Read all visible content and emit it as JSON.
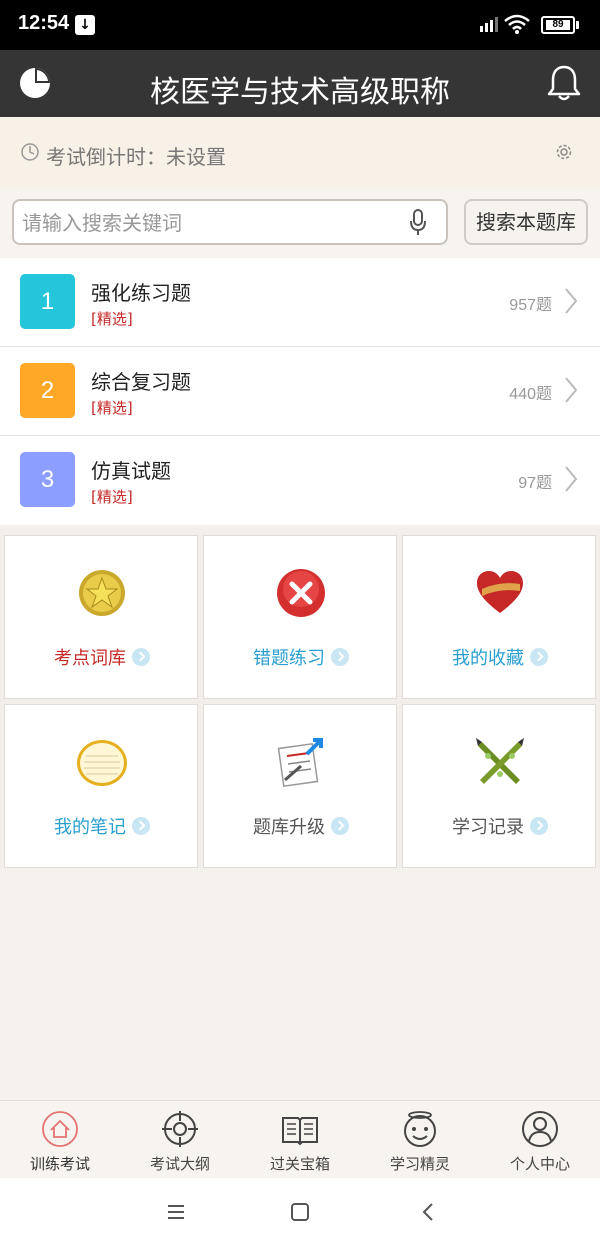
{
  "status_bar": {
    "time": "12:54",
    "battery": "89"
  },
  "header": {
    "title": "核医学与技术高级职称"
  },
  "countdown": {
    "label": "考试倒计时：未设置"
  },
  "search": {
    "placeholder": "请输入搜索关键词",
    "value": "",
    "button_label": "搜索本题库"
  },
  "banks": [
    {
      "number": "1",
      "title": "强化练习题",
      "tag": "[精选]",
      "count": "957题",
      "color": "#26c6da"
    },
    {
      "number": "2",
      "title": "综合复习题",
      "tag": "[精选]",
      "count": "440题",
      "color": "#ffa726"
    },
    {
      "number": "3",
      "title": "仿真试题",
      "tag": "[精选]",
      "count": "97题",
      "color": "#8c9eff"
    }
  ],
  "tiles": [
    {
      "label": "考点词库",
      "icon": "gold-star-badge-icon",
      "color": "#c62828"
    },
    {
      "label": "错题练习",
      "icon": "red-x-circle-icon",
      "color": "#2a9fd0"
    },
    {
      "label": "我的收藏",
      "icon": "red-heart-icon",
      "color": "#2a9fd0"
    },
    {
      "label": "我的笔记",
      "icon": "notepad-icon",
      "color": "#2a9fd0"
    },
    {
      "label": "题库升级",
      "icon": "document-upgrade-icon",
      "color": "#555555"
    },
    {
      "label": "学习记录",
      "icon": "crossed-pencils-icon",
      "color": "#555555"
    }
  ],
  "bottom_nav": [
    {
      "label": "训练考试",
      "icon": "home-icon",
      "active": true
    },
    {
      "label": "考试大纲",
      "icon": "target-icon",
      "active": false
    },
    {
      "label": "过关宝箱",
      "icon": "book-icon",
      "active": false
    },
    {
      "label": "学习精灵",
      "icon": "smiley-icon",
      "active": false
    },
    {
      "label": "个人中心",
      "icon": "user-icon",
      "active": false
    }
  ],
  "colors": {
    "header_bg": "#353535",
    "accent_red": "#c62828",
    "accent_blue": "#2a9fd0"
  }
}
